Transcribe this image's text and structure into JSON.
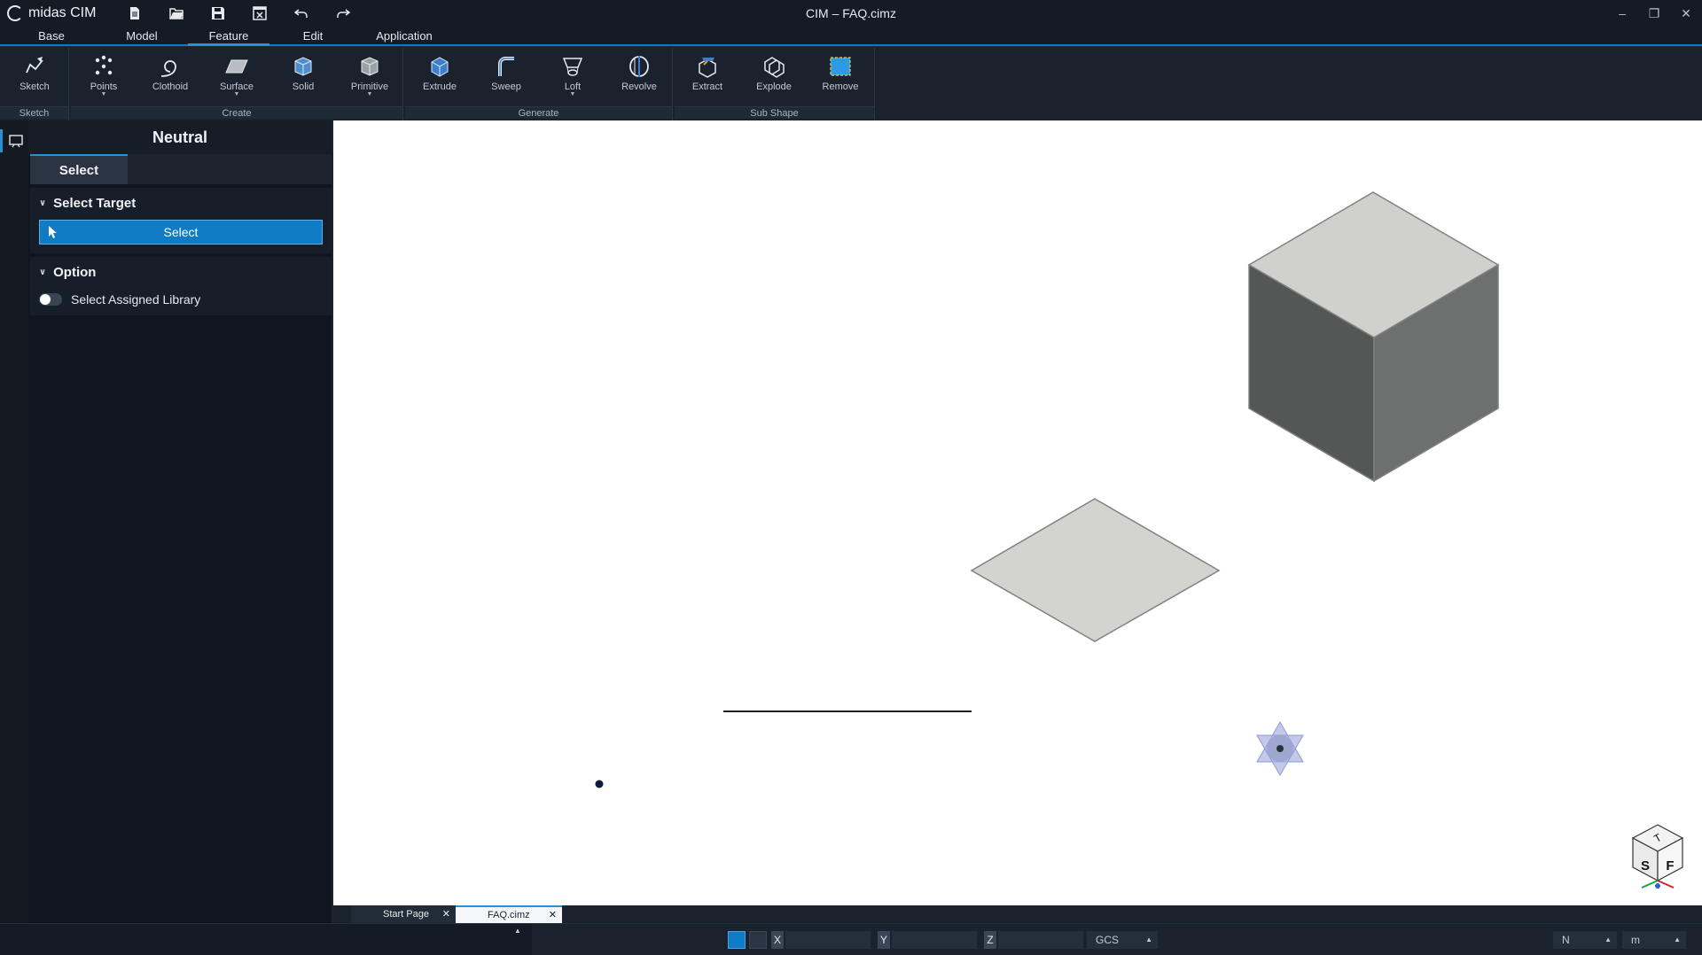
{
  "app": {
    "name": "midas CIM",
    "window_title": "CIM – FAQ.cimz"
  },
  "quick_access": [
    {
      "name": "new-file-icon"
    },
    {
      "name": "open-folder-icon"
    },
    {
      "name": "save-icon"
    },
    {
      "name": "close-file-icon"
    },
    {
      "name": "undo-icon"
    },
    {
      "name": "redo-icon"
    }
  ],
  "menu_tabs": [
    "Base",
    "Model",
    "Feature",
    "Edit",
    "Application"
  ],
  "active_menu_tab": "Feature",
  "ribbon": {
    "groups": [
      {
        "label": "Sketch",
        "buttons": [
          {
            "label": "Sketch",
            "icon": "sketch-icon"
          }
        ]
      },
      {
        "label": "Create",
        "buttons": [
          {
            "label": "Points",
            "icon": "points-icon",
            "dropdown": true
          },
          {
            "label": "Clothoid",
            "icon": "clothoid-icon"
          },
          {
            "label": "Surface",
            "icon": "surface-icon",
            "dropdown": true
          },
          {
            "label": "Solid",
            "icon": "solid-icon"
          },
          {
            "label": "Primitive",
            "icon": "primitive-icon",
            "dropdown": true
          }
        ]
      },
      {
        "label": "Generate",
        "buttons": [
          {
            "label": "Extrude",
            "icon": "extrude-icon"
          },
          {
            "label": "Sweep",
            "icon": "sweep-icon"
          },
          {
            "label": "Loft",
            "icon": "loft-icon",
            "dropdown": true
          },
          {
            "label": "Revolve",
            "icon": "revolve-icon"
          }
        ]
      },
      {
        "label": "Sub Shape",
        "buttons": [
          {
            "label": "Extract",
            "icon": "extract-icon"
          },
          {
            "label": "Explode",
            "icon": "explode-icon"
          },
          {
            "label": "Remove",
            "icon": "remove-icon"
          }
        ]
      }
    ]
  },
  "panel": {
    "title": "Neutral",
    "tab": "Select",
    "select_target": {
      "heading": "Select Target",
      "button_label": "Select"
    },
    "option": {
      "heading": "Option",
      "toggle_label": "Select Assigned Library",
      "toggle_on": false
    }
  },
  "doc_tabs": [
    {
      "label": "Start Page",
      "active": false
    },
    {
      "label": "FAQ.cimz",
      "active": true
    }
  ],
  "statusbar": {
    "x_label": "X",
    "y_label": "Y",
    "z_label": "Z",
    "coord_system": "GCS",
    "force_unit": "N",
    "length_unit": "m"
  },
  "view_cube": {
    "top": "T",
    "left": "S",
    "right": "F"
  }
}
